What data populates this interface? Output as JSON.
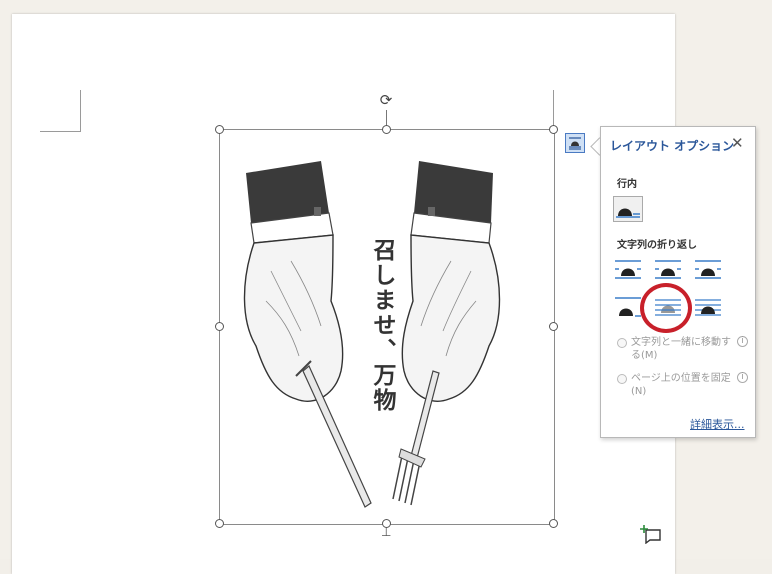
{
  "panel": {
    "title": "レイアウト オプション",
    "close": "✕",
    "section_inline": "行内",
    "section_wrap": "文字列の折り返し",
    "option_move": "文字列と一緒に移動する(M)",
    "option_fix": "ページ上の位置を固定(N)",
    "details": "詳細表示...",
    "info": "i"
  },
  "artwork": {
    "vertical_text": "召しませ、万物"
  },
  "icons": {
    "rotate": "⟳",
    "anchor": "⊥",
    "comment": "new-comment-icon"
  },
  "colors": {
    "accent": "#2b579a",
    "highlight": "#c8202a",
    "icon_blue": "#3a7dc9"
  }
}
